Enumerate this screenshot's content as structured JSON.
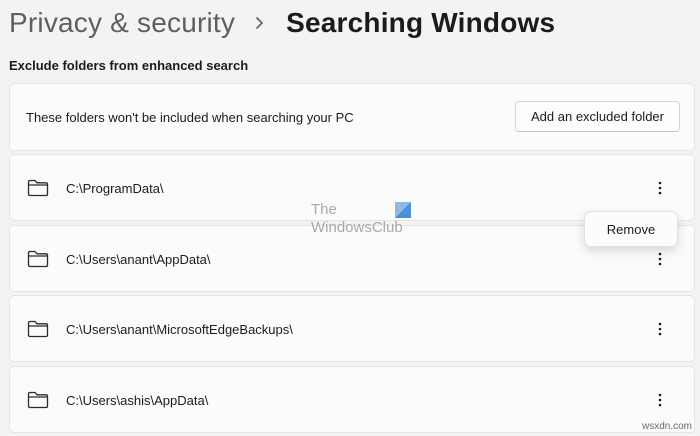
{
  "breadcrumb": {
    "parent": "Privacy & security",
    "separator": "›",
    "current": "Searching Windows"
  },
  "section": {
    "title": "Exclude folders from enhanced search"
  },
  "info_card": {
    "text": "These folders won't be included when searching your PC",
    "add_button_label": "Add an excluded folder"
  },
  "folders": [
    {
      "path": "C:\\ProgramData\\",
      "icon": "folder-icon",
      "more_icon": "more-vertical-icon"
    },
    {
      "path": "C:\\Users\\anant\\AppData\\",
      "icon": "folder-icon",
      "more_icon": "more-vertical-icon"
    },
    {
      "path": "C:\\Users\\anant\\MicrosoftEdgeBackups\\",
      "icon": "folder-icon",
      "more_icon": "more-vertical-icon"
    },
    {
      "path": "C:\\Users\\ashis\\AppData\\",
      "icon": "folder-icon",
      "more_icon": "more-vertical-icon"
    }
  ],
  "context_menu": {
    "remove_label": "Remove"
  },
  "watermark": {
    "line1": "The",
    "line2": "WindowsClub"
  },
  "site_mark": "wsxdn.com",
  "colors": {
    "background": "#f3f3f3",
    "card": "#fbfbfb",
    "border": "#e5e5e5",
    "text": "#1b1b1b",
    "muted": "#5f5f5f",
    "watermark_accent": "#4a8fd8"
  }
}
